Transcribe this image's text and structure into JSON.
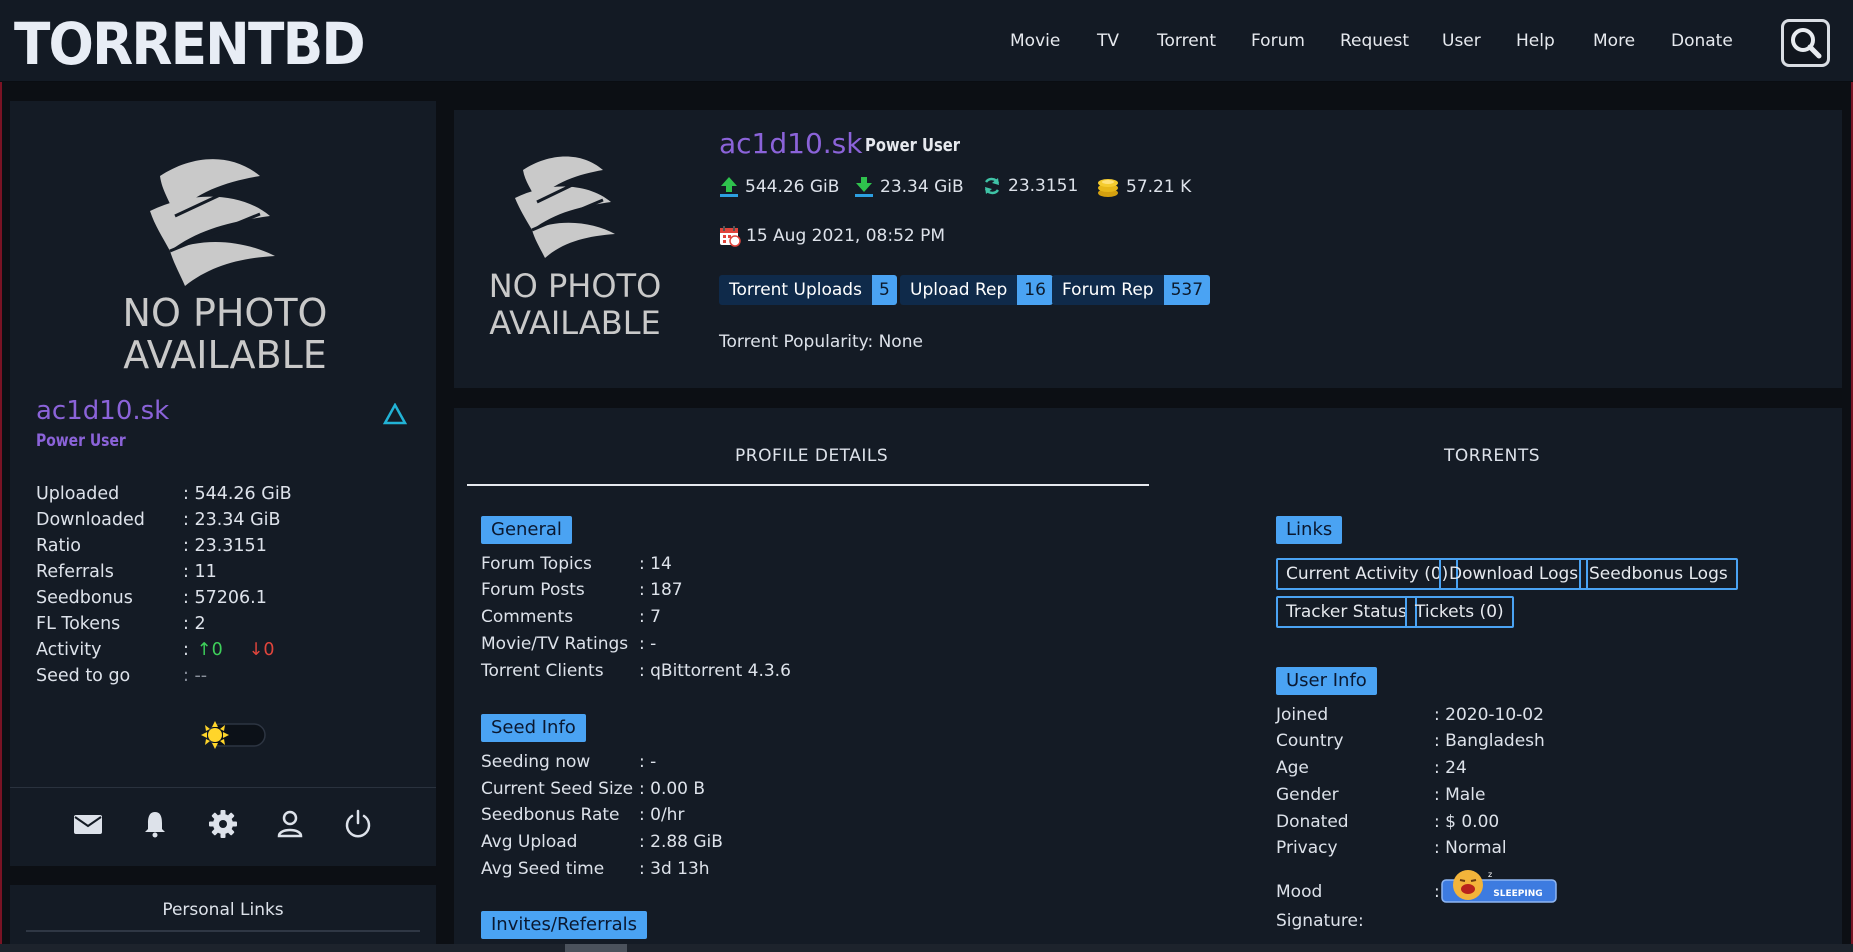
{
  "site": {
    "logo_text": "TORRENTBD"
  },
  "nav": {
    "items": [
      "Movie",
      "TV",
      "Torrent",
      "Forum",
      "Request",
      "User",
      "Help",
      "More",
      "Donate"
    ]
  },
  "sidebar": {
    "no_photo_line1": "NO PHOTO",
    "no_photo_line2": "AVAILABLE",
    "username": "ac1d10.sk",
    "user_class": "Power User",
    "stats": [
      {
        "label": "Uploaded",
        "value": ": 544.26 GiB"
      },
      {
        "label": "Downloaded",
        "value": ": 23.34 GiB"
      },
      {
        "label": "Ratio",
        "value": ": 23.3151"
      },
      {
        "label": "Referrals",
        "value": ": 11"
      },
      {
        "label": "Seedbonus",
        "value": ": 57206.1"
      },
      {
        "label": "FL Tokens",
        "value": ": 2"
      },
      {
        "label": "Activity",
        "value": ":"
      },
      {
        "label": "Seed to go",
        "value": ": --"
      }
    ],
    "activity_up": "↑0",
    "activity_down": "↓0",
    "theme_toggle_on": false,
    "icons": [
      "mail-icon",
      "bell-icon",
      "gear-icon",
      "user-icon",
      "power-icon"
    ]
  },
  "personal_links": {
    "title": "Personal Links"
  },
  "profile": {
    "no_photo_line1": "NO PHOTO",
    "no_photo_line2": "AVAILABLE",
    "username": "ac1d10.sk",
    "user_class": "Power User",
    "uploaded": "544.26 GiB",
    "downloaded": "23.34 GiB",
    "ratio": "23.3151",
    "seedbonus": "57.21 K",
    "joined_datetime": "15 Aug 2021, 08:52 PM",
    "badges": [
      {
        "label": "Torrent Uploads",
        "value": "5"
      },
      {
        "label": "Upload Rep",
        "value": "16"
      },
      {
        "label": "Forum Rep",
        "value": "537"
      }
    ],
    "popularity": "Torrent Popularity: None"
  },
  "tabs": {
    "profile_details": "PROFILE DETAILS",
    "torrents": "TORRENTS"
  },
  "general": {
    "title": "General",
    "rows": [
      {
        "k": "Forum Topics",
        "v": ": 14"
      },
      {
        "k": "Forum Posts",
        "v": ": 187"
      },
      {
        "k": "Comments",
        "v": ": 7"
      },
      {
        "k": "Movie/TV Ratings",
        "v": ": -"
      },
      {
        "k": "Torrent Clients",
        "v": ": qBittorrent 4.3.6"
      }
    ]
  },
  "seed_info": {
    "title": "Seed Info",
    "rows": [
      {
        "k": "Seeding now",
        "v": ": -"
      },
      {
        "k": "Current Seed Size",
        "v": ": 0.00 B"
      },
      {
        "k": "Seedbonus Rate",
        "v": ": 0/hr"
      },
      {
        "k": "Avg Upload",
        "v": ": 2.88 GiB"
      },
      {
        "k": "Avg Seed time",
        "v": ": 3d 13h"
      }
    ]
  },
  "invites": {
    "title": "Invites/Referrals"
  },
  "links": {
    "title": "Links",
    "buttons": [
      "Current Activity (0)",
      "Download Logs",
      "Seedbonus Logs",
      "Tracker Status",
      "Tickets (0)"
    ]
  },
  "user_info": {
    "title": "User Info",
    "rows": [
      {
        "k": "Joined",
        "v": ": 2020-10-02"
      },
      {
        "k": "Country",
        "v": ": Bangladesh"
      },
      {
        "k": "Age",
        "v": ": 24"
      },
      {
        "k": "Gender",
        "v": ": Male"
      },
      {
        "k": "Donated",
        "v": ": $ 0.00"
      },
      {
        "k": "Privacy",
        "v": ": Normal"
      }
    ],
    "mood_label": "Mood",
    "mood_colon": ":",
    "mood_text": "SLEEPING",
    "signature_label": "Signature:"
  },
  "colors": {
    "accent": "#4aa3f3",
    "username": "#8b63d9",
    "bg": "#0c0f14",
    "card": "#141b25",
    "up": "#3ecf5a",
    "down": "#e0453c"
  }
}
